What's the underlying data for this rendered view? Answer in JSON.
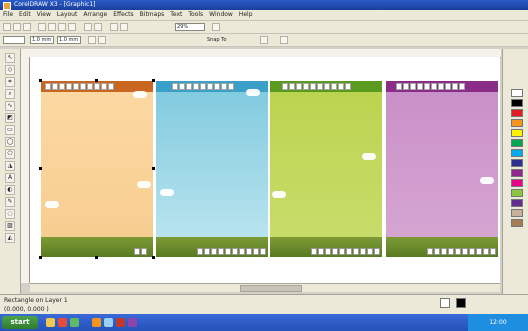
{
  "window": {
    "title": "CorelDRAW X3 - [Graphic1]"
  },
  "menu": [
    "File",
    "Edit",
    "View",
    "Layout",
    "Arrange",
    "Effects",
    "Bitmaps",
    "Text",
    "Tools",
    "Window",
    "Help"
  ],
  "toolbar": {
    "zoom_value": "29%",
    "snap_label": "Snap To",
    "x_value": "1.0 mm",
    "y_value": "1.0 mm"
  },
  "pages": [
    {
      "name": "orange",
      "bg_top": "#fcd9a3",
      "bg_bottom": "#f6cc8f",
      "header": "#c9661f"
    },
    {
      "name": "blue",
      "bg_top": "#7ec9de",
      "bg_bottom": "#bfe7f0",
      "header": "#3aa0c8"
    },
    {
      "name": "green",
      "bg_top": "#b9d34d",
      "bg_bottom": "#c9de6e",
      "header": "#5a9a1f"
    },
    {
      "name": "purple",
      "bg_top": "#c98ec8",
      "bg_bottom": "#d7a8d2",
      "header": "#8a2c88"
    }
  ],
  "palette_colors": [
    "#ffffff",
    "#000000",
    "#e31c23",
    "#f7941d",
    "#fff200",
    "#00a651",
    "#00aeef",
    "#2e3192",
    "#92278f",
    "#ec008c",
    "#8dc63f",
    "#662d91",
    "#c7b299",
    "#a67c52"
  ],
  "status": {
    "line1": "Rectangle on Layer 1",
    "line2": "(0.000, 0.000 )"
  },
  "taskbar": {
    "start_label": "start",
    "clock": "12:00"
  }
}
